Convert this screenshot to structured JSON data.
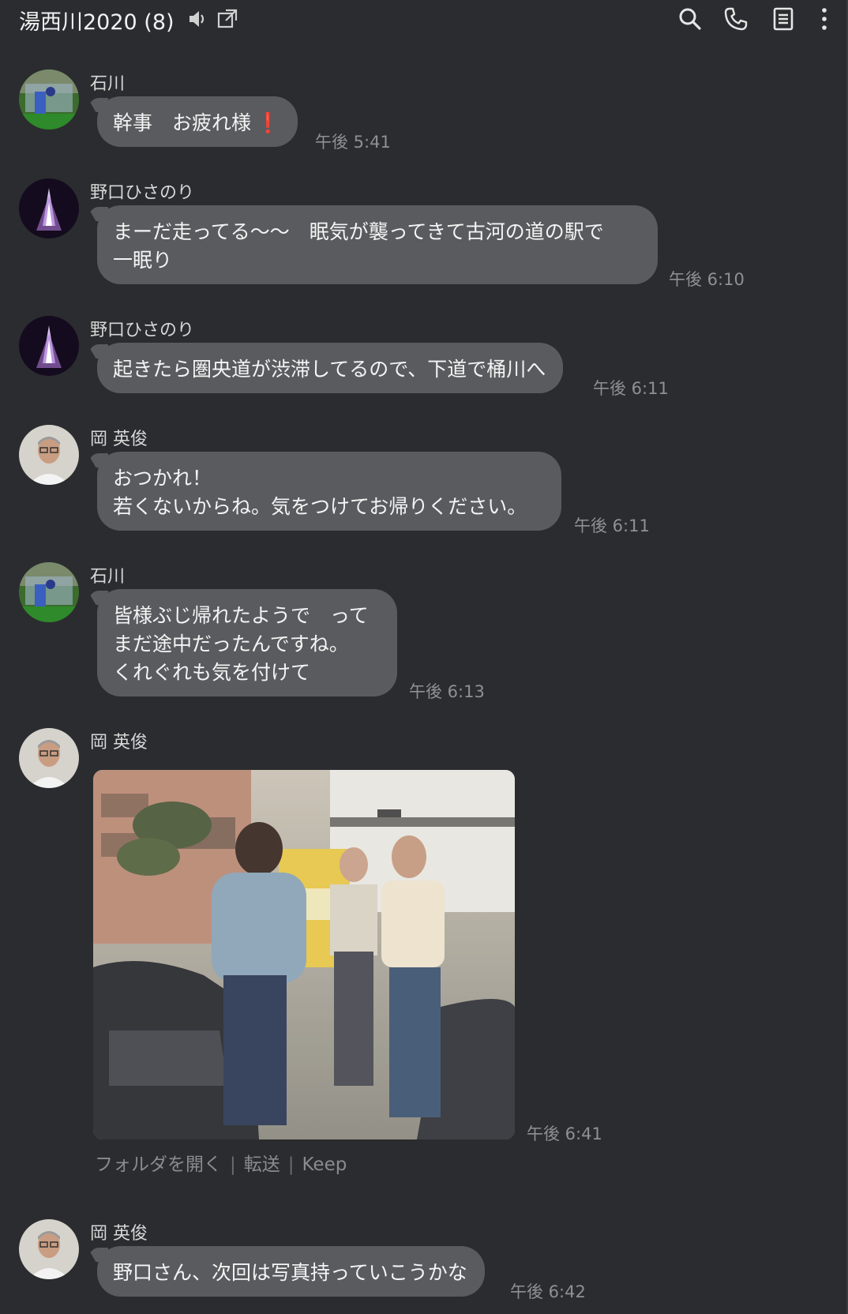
{
  "header": {
    "title": "湯西川2020 (8)",
    "icons": [
      "speaker-icon",
      "external-window-icon",
      "search-icon",
      "phone-icon",
      "notes-icon",
      "more-vertical-icon"
    ]
  },
  "messages": [
    {
      "sender": "石川",
      "text": "幹事　お疲れ様",
      "emoji": "❗",
      "time": "午後 5:41",
      "avatar": "ishikawa"
    },
    {
      "sender": "野口ひさのり",
      "text": "まーだ走ってる〜〜　眠気が襲ってきて古河の道の駅で\n一眠り",
      "time": "午後 6:10",
      "avatar": "noguchi"
    },
    {
      "sender": "野口ひさのり",
      "text": "起きたら圏央道が渋滞してるので、下道で桶川へ",
      "time": "午後 6:11",
      "avatar": "noguchi"
    },
    {
      "sender": "岡 英俊",
      "text": "おつかれ！\n若くないからね。気をつけてお帰りください。",
      "time": "午後 6:11",
      "avatar": "oka"
    },
    {
      "sender": "石川",
      "text": "皆様ぶじ帰れたようで　って\nまだ途中だったんですね。\nくれぐれも気を付けて",
      "time": "午後 6:13",
      "avatar": "ishikawa"
    },
    {
      "sender": "岡 英俊",
      "time": "午後 6:41",
      "avatar": "oka",
      "type": "photo"
    },
    {
      "sender": "岡 英俊",
      "text": "野口さん、次回は写真持っていこうかな",
      "time": "午後 6:42",
      "avatar": "oka"
    }
  ],
  "photo_actions": {
    "open_folder": "フォルダを開く",
    "separator": "|",
    "forward": "転送",
    "keep": "Keep"
  },
  "colors": {
    "background": "#2b2c2f",
    "bubble": "#5a5b5e",
    "timestamp": "#8f9094",
    "emoji_red": "#e0202a"
  }
}
